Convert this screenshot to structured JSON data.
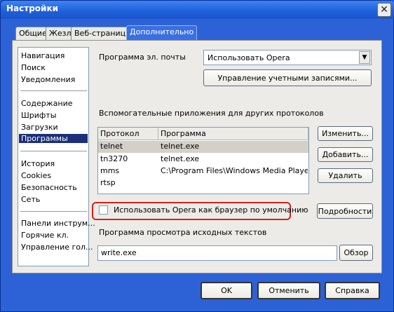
{
  "window": {
    "title": "Настройки"
  },
  "tabs": [
    {
      "label": "Общие"
    },
    {
      "label": "Жезл"
    },
    {
      "label": "Веб-страницы"
    },
    {
      "label": "Дополнительно"
    }
  ],
  "sidebar": {
    "group1": [
      "Навигация",
      "Поиск",
      "Уведомления"
    ],
    "group2": [
      "Содержание",
      "Шрифты",
      "Загрузки",
      "Программы"
    ],
    "group3": [
      "История",
      "Cookies",
      "Безопасность",
      "Сеть"
    ],
    "group4": [
      "Панели инструм...",
      "Горячие кл.",
      "Управление гол..."
    ],
    "selected": "Программы"
  },
  "mail": {
    "label": "Программа эл. почты",
    "selected": "Использовать Opera",
    "manage_button": "Управление учетными записями..."
  },
  "protocols": {
    "label": "Вспомогательные приложения для других протоколов",
    "columns": [
      "Протокол",
      "Программа"
    ],
    "rows": [
      {
        "protocol": "telnet",
        "program": "telnet.exe"
      },
      {
        "protocol": "tn3270",
        "program": "telnet.exe"
      },
      {
        "protocol": "mms",
        "program": "C:\\Program Files\\Windows Media Player\\..."
      },
      {
        "protocol": "rtsp",
        "program": ""
      }
    ],
    "edit_button": "Изменить...",
    "add_button": "Добавить...",
    "delete_button": "Удалить"
  },
  "default_browser": {
    "label": "Использовать Opera как браузер по умолчанию",
    "checked": false,
    "details_button": "Подробности"
  },
  "source_viewer": {
    "label": "Программа просмотра исходных текстов",
    "value": "write.exe",
    "browse_button": "Обзор"
  },
  "footer": {
    "ok": "OK",
    "cancel": "Отменить",
    "help": "Справка"
  }
}
